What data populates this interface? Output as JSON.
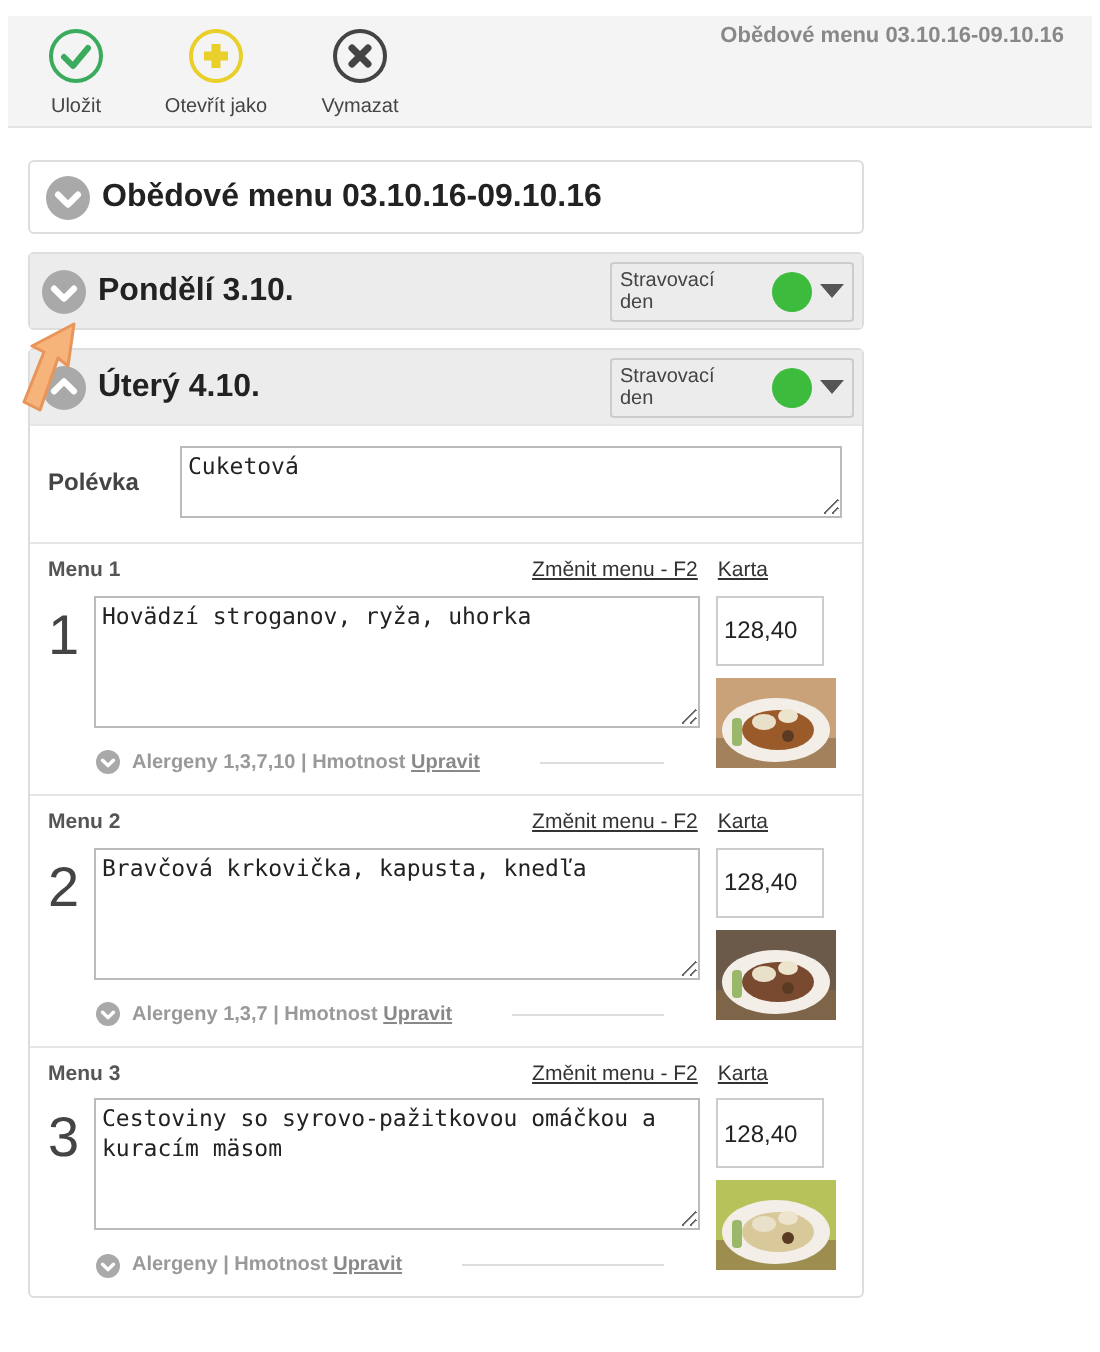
{
  "toolbar": {
    "buttons": [
      {
        "kind": "save",
        "label": "Uložit"
      },
      {
        "kind": "open",
        "label": "Otevřít jako"
      },
      {
        "kind": "delete",
        "label": "Vymazat"
      }
    ],
    "title": "Obědové menu 03.10.16-09.10.16"
  },
  "week": {
    "title": "Obědové menu 03.10.16-09.10.16",
    "expanded": false
  },
  "days": [
    {
      "title": "Pondělí 3.10.",
      "expanded": false,
      "status": "Stravovací den",
      "color": "#3dbb3d"
    },
    {
      "title": "Úterý 4.10.",
      "expanded": true,
      "status": "Stravovací den",
      "color": "#3dbb3d",
      "soup_label": "Polévka",
      "soup": "Cuketová",
      "menus": [
        {
          "label": "Menu 1",
          "number": "1",
          "change_link": "Změnit menu - F2",
          "card_link": "Karta",
          "dish": "Hovädzí stroganov, ryža, uhorka",
          "price": "128,40",
          "allergens": "Alergeny 1,3,7,10 | Hmotnost",
          "edit_link": "Upravit"
        },
        {
          "label": "Menu 2",
          "number": "2",
          "change_link": "Změnit menu - F2",
          "card_link": "Karta",
          "dish": "Bravčová krkovička, kapusta, knedľa",
          "price": "128,40",
          "allergens": "Alergeny 1,3,7 | Hmotnost",
          "edit_link": "Upravit"
        },
        {
          "label": "Menu 3",
          "number": "3",
          "change_link": "Změnit menu - F2",
          "card_link": "Karta",
          "dish": "Cestoviny so syrovo-pažitkovou omáčkou a kuracím mäsom",
          "price": "128,40",
          "allergens": "Alergeny | Hmotnost",
          "edit_link": "Upravit"
        }
      ]
    }
  ]
}
